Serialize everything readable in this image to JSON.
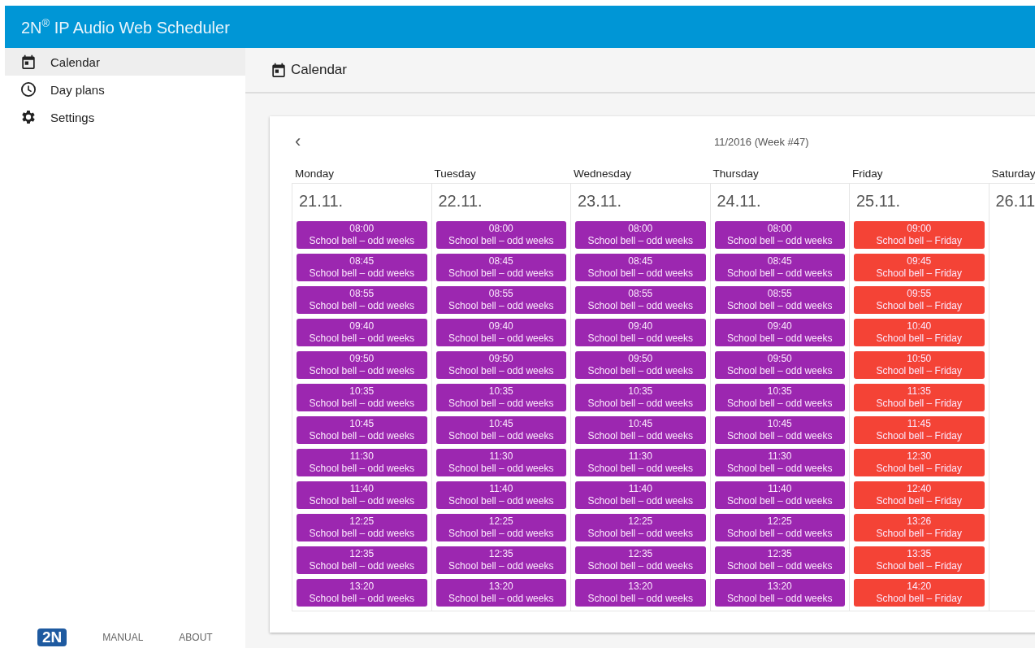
{
  "app_title": {
    "brand": "2N$^{®}$ IP Audio Web Scheduler"
  },
  "sidebar": {
    "items": [
      {
        "label": "Calendar",
        "selected": true
      },
      {
        "label": "Day plans",
        "selected": false
      },
      {
        "label": "Settings",
        "selected": false
      }
    ],
    "footer": {
      "logo": "2N",
      "links": [
        "MANUAL",
        "ABOUT"
      ]
    }
  },
  "page_header": {
    "title": "Calendar"
  },
  "calendar": {
    "prev": "‹",
    "period": "11/2016 (Week #47)",
    "days": [
      {
        "name": "Monday",
        "date": "21.11.",
        "events": [
          {
            "time": "08:00",
            "title": "School bell – odd weeks",
            "color": "#9c27b0"
          },
          {
            "time": "08:45",
            "title": "School bell – odd weeks",
            "color": "#9c27b0"
          },
          {
            "time": "08:55",
            "title": "School bell – odd weeks",
            "color": "#9c27b0"
          },
          {
            "time": "09:40",
            "title": "School bell – odd weeks",
            "color": "#9c27b0"
          },
          {
            "time": "09:50",
            "title": "School bell – odd weeks",
            "color": "#9c27b0"
          },
          {
            "time": "10:35",
            "title": "School bell – odd weeks",
            "color": "#9c27b0"
          },
          {
            "time": "10:45",
            "title": "School bell – odd weeks",
            "color": "#9c27b0"
          },
          {
            "time": "11:30",
            "title": "School bell – odd weeks",
            "color": "#9c27b0"
          },
          {
            "time": "11:40",
            "title": "School bell – odd weeks",
            "color": "#9c27b0"
          },
          {
            "time": "12:25",
            "title": "School bell – odd weeks",
            "color": "#9c27b0"
          },
          {
            "time": "12:35",
            "title": "School bell – odd weeks",
            "color": "#9c27b0"
          },
          {
            "time": "13:20",
            "title": "School bell – odd weeks",
            "color": "#9c27b0"
          }
        ]
      },
      {
        "name": "Tuesday",
        "date": "22.11.",
        "events": [
          {
            "time": "08:00",
            "title": "School bell – odd weeks",
            "color": "#9c27b0"
          },
          {
            "time": "08:45",
            "title": "School bell – odd weeks",
            "color": "#9c27b0"
          },
          {
            "time": "08:55",
            "title": "School bell – odd weeks",
            "color": "#9c27b0"
          },
          {
            "time": "09:40",
            "title": "School bell – odd weeks",
            "color": "#9c27b0"
          },
          {
            "time": "09:50",
            "title": "School bell – odd weeks",
            "color": "#9c27b0"
          },
          {
            "time": "10:35",
            "title": "School bell – odd weeks",
            "color": "#9c27b0"
          },
          {
            "time": "10:45",
            "title": "School bell – odd weeks",
            "color": "#9c27b0"
          },
          {
            "time": "11:30",
            "title": "School bell – odd weeks",
            "color": "#9c27b0"
          },
          {
            "time": "11:40",
            "title": "School bell – odd weeks",
            "color": "#9c27b0"
          },
          {
            "time": "12:25",
            "title": "School bell – odd weeks",
            "color": "#9c27b0"
          },
          {
            "time": "12:35",
            "title": "School bell – odd weeks",
            "color": "#9c27b0"
          },
          {
            "time": "13:20",
            "title": "School bell – odd weeks",
            "color": "#9c27b0"
          }
        ]
      },
      {
        "name": "Wednesday",
        "date": "23.11.",
        "events": [
          {
            "time": "08:00",
            "title": "School bell – odd weeks",
            "color": "#9c27b0"
          },
          {
            "time": "08:45",
            "title": "School bell – odd weeks",
            "color": "#9c27b0"
          },
          {
            "time": "08:55",
            "title": "School bell – odd weeks",
            "color": "#9c27b0"
          },
          {
            "time": "09:40",
            "title": "School bell – odd weeks",
            "color": "#9c27b0"
          },
          {
            "time": "09:50",
            "title": "School bell – odd weeks",
            "color": "#9c27b0"
          },
          {
            "time": "10:35",
            "title": "School bell – odd weeks",
            "color": "#9c27b0"
          },
          {
            "time": "10:45",
            "title": "School bell – odd weeks",
            "color": "#9c27b0"
          },
          {
            "time": "11:30",
            "title": "School bell – odd weeks",
            "color": "#9c27b0"
          },
          {
            "time": "11:40",
            "title": "School bell – odd weeks",
            "color": "#9c27b0"
          },
          {
            "time": "12:25",
            "title": "School bell – odd weeks",
            "color": "#9c27b0"
          },
          {
            "time": "12:35",
            "title": "School bell – odd weeks",
            "color": "#9c27b0"
          },
          {
            "time": "13:20",
            "title": "School bell – odd weeks",
            "color": "#9c27b0"
          }
        ]
      },
      {
        "name": "Thursday",
        "date": "24.11.",
        "events": [
          {
            "time": "08:00",
            "title": "School bell – odd weeks",
            "color": "#9c27b0"
          },
          {
            "time": "08:45",
            "title": "School bell – odd weeks",
            "color": "#9c27b0"
          },
          {
            "time": "08:55",
            "title": "School bell – odd weeks",
            "color": "#9c27b0"
          },
          {
            "time": "09:40",
            "title": "School bell – odd weeks",
            "color": "#9c27b0"
          },
          {
            "time": "09:50",
            "title": "School bell – odd weeks",
            "color": "#9c27b0"
          },
          {
            "time": "10:35",
            "title": "School bell – odd weeks",
            "color": "#9c27b0"
          },
          {
            "time": "10:45",
            "title": "School bell – odd weeks",
            "color": "#9c27b0"
          },
          {
            "time": "11:30",
            "title": "School bell – odd weeks",
            "color": "#9c27b0"
          },
          {
            "time": "11:40",
            "title": "School bell – odd weeks",
            "color": "#9c27b0"
          },
          {
            "time": "12:25",
            "title": "School bell – odd weeks",
            "color": "#9c27b0"
          },
          {
            "time": "12:35",
            "title": "School bell – odd weeks",
            "color": "#9c27b0"
          },
          {
            "time": "13:20",
            "title": "School bell – odd weeks",
            "color": "#9c27b0"
          }
        ]
      },
      {
        "name": "Friday",
        "date": "25.11.",
        "events": [
          {
            "time": "09:00",
            "title": "School bell – Friday",
            "color": "#f44336"
          },
          {
            "time": "09:45",
            "title": "School bell – Friday",
            "color": "#f44336"
          },
          {
            "time": "09:55",
            "title": "School bell – Friday",
            "color": "#f44336"
          },
          {
            "time": "10:40",
            "title": "School bell – Friday",
            "color": "#f44336"
          },
          {
            "time": "10:50",
            "title": "School bell – Friday",
            "color": "#f44336"
          },
          {
            "time": "11:35",
            "title": "School bell – Friday",
            "color": "#f44336"
          },
          {
            "time": "11:45",
            "title": "School bell – Friday",
            "color": "#f44336"
          },
          {
            "time": "12:30",
            "title": "School bell – Friday",
            "color": "#f44336"
          },
          {
            "time": "12:40",
            "title": "School bell – Friday",
            "color": "#f44336"
          },
          {
            "time": "13:26",
            "title": "School bell – Friday",
            "color": "#f44336"
          },
          {
            "time": "13:35",
            "title": "School bell – Friday",
            "color": "#f44336"
          },
          {
            "time": "14:20",
            "title": "School bell – Friday",
            "color": "#f44336"
          }
        ]
      },
      {
        "name": "Saturday",
        "date": "26.11"
      }
    ]
  }
}
